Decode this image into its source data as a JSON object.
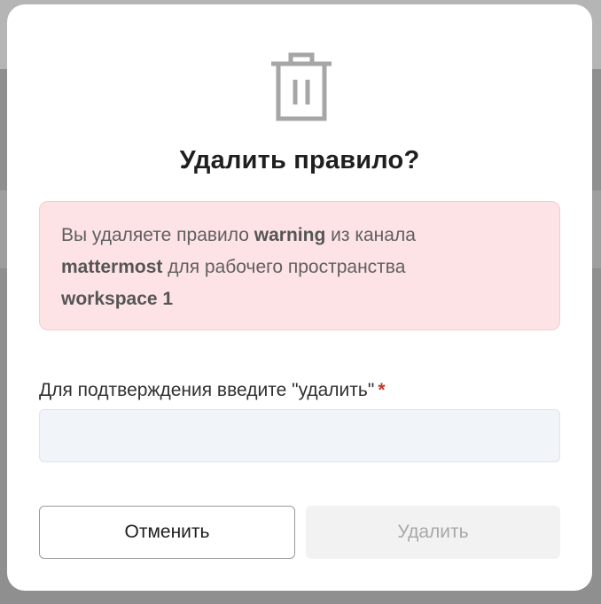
{
  "dialog": {
    "title": "Удалить правило?",
    "icon": "trash-icon",
    "alert": {
      "part1": "Вы удаляете правило ",
      "rule_name": "warning",
      "part2": " из канала ",
      "channel_name": "mattermost",
      "part3": " для рабочего пространства ",
      "workspace_name": "workspace 1"
    },
    "confirm_label": "Для подтверждения введите \"удалить\"",
    "required_mark": "*",
    "confirm_input_value": "",
    "cancel_label": "Отменить",
    "delete_label": "Удалить"
  },
  "colors": {
    "alert_bg": "#fde3e6",
    "required": "#c0392b",
    "disabled_text": "#a8a8a8"
  }
}
